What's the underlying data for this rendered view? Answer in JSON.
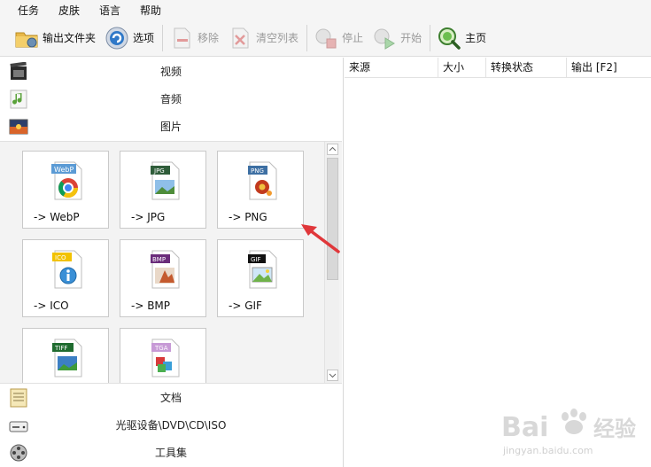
{
  "menu": [
    "任务",
    "皮肤",
    "语言",
    "帮助"
  ],
  "toolbar": {
    "output_folder": "输出文件夹",
    "options": "选项",
    "remove": "移除",
    "clear_list": "清空列表",
    "stop": "停止",
    "start": "开始",
    "home": "主页"
  },
  "categories": {
    "video": "视频",
    "audio": "音频",
    "image": "图片",
    "document": "文档",
    "disc": "光驱设备\\DVD\\CD\\ISO",
    "tools": "工具集"
  },
  "tiles": [
    {
      "label": "-> WebP",
      "badge": "WebP"
    },
    {
      "label": "-> JPG",
      "badge": "JPG"
    },
    {
      "label": "-> PNG",
      "badge": "PNG"
    },
    {
      "label": "-> ICO",
      "badge": "ICO"
    },
    {
      "label": "-> BMP",
      "badge": "BMP"
    },
    {
      "label": "-> GIF",
      "badge": "GIF"
    },
    {
      "label": "",
      "badge": "TIFF"
    },
    {
      "label": "",
      "badge": "TGA"
    }
  ],
  "table_headers": [
    "来源",
    "大小",
    "转换状态",
    "输出 [F2]"
  ],
  "watermark": {
    "brand": "Bai",
    "brand2": "经验",
    "url": "jingyan.baidu.com"
  },
  "colors": {
    "accent": "#e0373a",
    "webp_badge": "#5b9bd5",
    "jpg_badge": "#2f5d3a",
    "png_badge": "#3d6fa3",
    "ico_badge": "#f2c200",
    "bmp_badge": "#6a2c7a",
    "gif_badge": "#111111",
    "tiff_badge": "#1f6b2f",
    "tga_badge": "#c79ad6"
  }
}
